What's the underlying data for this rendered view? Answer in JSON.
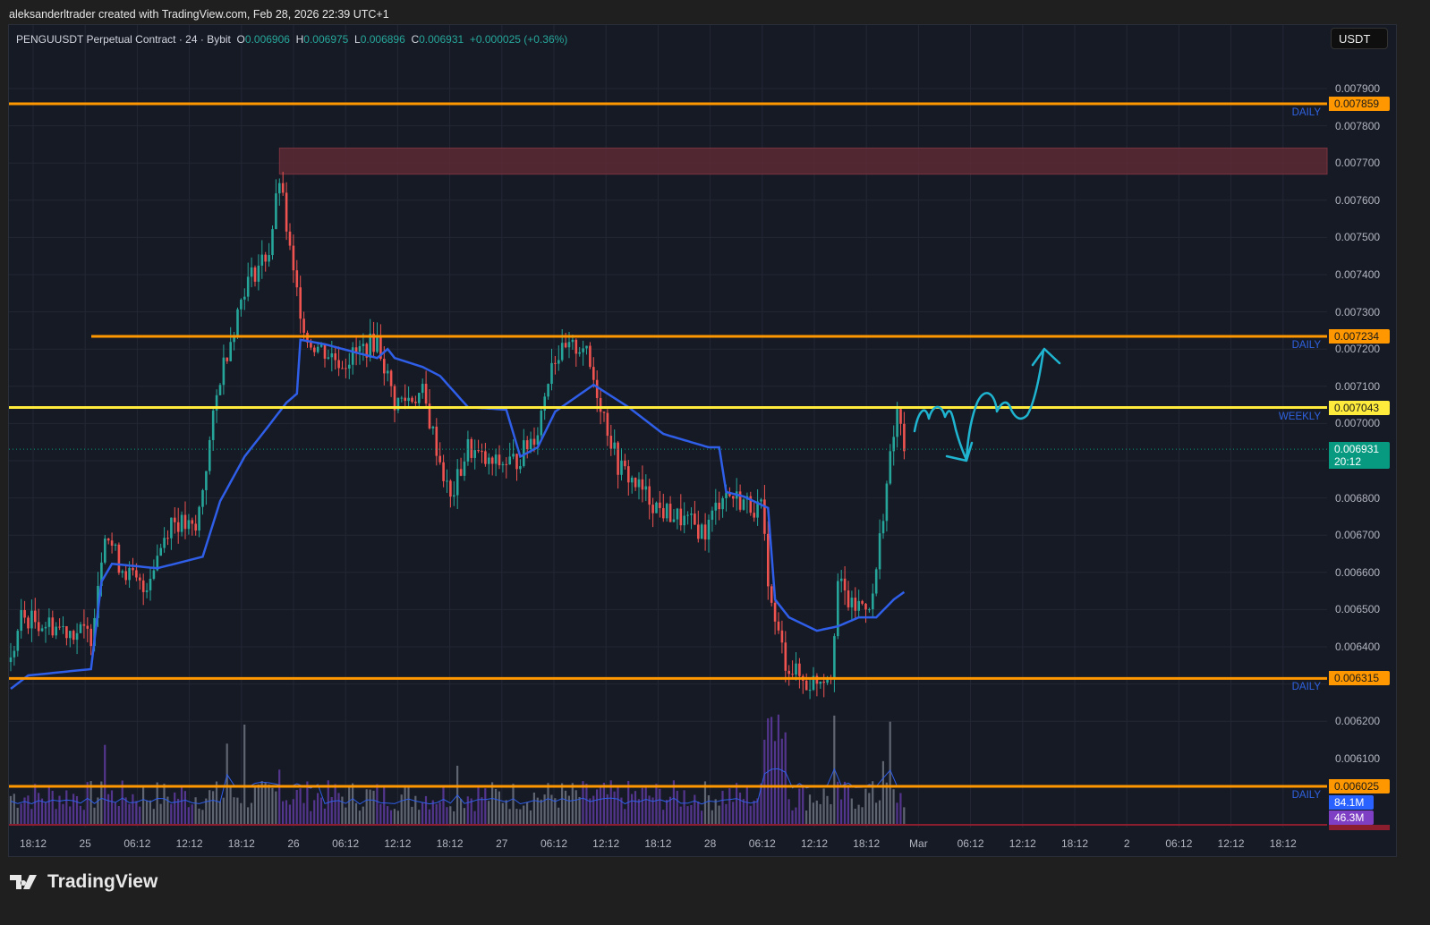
{
  "credit": "aleksanderltrader created with TradingView.com, Feb 28, 2026 22:39 UTC+1",
  "legend": {
    "symbol": "PENGUUSDT Perpetual Contract · 24 · Bybit",
    "o_label": "O",
    "o": "0.006906",
    "h_label": "H",
    "h": "0.006975",
    "l_label": "L",
    "l": "0.006896",
    "c_label": "C",
    "c": "0.006931",
    "change": "+0.000025 (+0.36%)"
  },
  "currency_button": "USDT",
  "price_axis": {
    "range": [
      0.00588,
      0.00798
    ],
    "labels": [
      "0.007900",
      "0.007800",
      "0.007700",
      "0.007600",
      "0.007500",
      "0.007400",
      "0.007300",
      "0.007200",
      "0.007100",
      "0.007000",
      "0.006800",
      "0.006700",
      "0.006600",
      "0.006500",
      "0.006400",
      "0.006200",
      "0.006100"
    ]
  },
  "levels": [
    {
      "price": 0.007859,
      "label": "0.007859",
      "name": "DAILY",
      "color": "#ff9800",
      "start_index": 0
    },
    {
      "price": 0.007234,
      "label": "0.007234",
      "name": "DAILY",
      "color": "#ff9800",
      "start_index": 24
    },
    {
      "price": 0.007043,
      "label": "0.007043",
      "name": "WEEKLY",
      "color": "#ffeb3b",
      "start_index": 0
    },
    {
      "price": 0.006315,
      "label": "0.006315",
      "name": "DAILY",
      "color": "#ff9800",
      "start_index": 0
    },
    {
      "price": 0.006025,
      "label": "0.006025",
      "name": "DAILY",
      "color": "#ff9800",
      "start_index": 0
    }
  ],
  "supply_zone": {
    "top": 0.00774,
    "bottom": 0.00767,
    "start_index": 77,
    "color": "#5c2a35"
  },
  "current_price": {
    "label": "0.006931",
    "countdown": "20:12",
    "color": "#089981"
  },
  "volume_tags": [
    {
      "label": "84.1M",
      "color": "#2962ff"
    },
    {
      "label": "46.3M",
      "color": "#7e3fc4"
    }
  ],
  "time_axis": [
    "18:12",
    "25",
    "06:12",
    "12:12",
    "18:12",
    "26",
    "06:12",
    "12:12",
    "18:12",
    "27",
    "06:12",
    "12:12",
    "18:12",
    "28",
    "06:12",
    "12:12",
    "18:12",
    "Mar",
    "06:12",
    "12:12",
    "18:12",
    "2",
    "06:12",
    "12:12",
    "18:12"
  ],
  "colors": {
    "up": "#26a69a",
    "down": "#ef5350",
    "ma": "#2f5ee8",
    "annotation": "#1fb5d1"
  },
  "chart_data": {
    "type": "candlestick",
    "symbol": "PENGUUSDT",
    "interval_minutes": 24,
    "candles_per_time_label": 15,
    "close_waypoints": [
      [
        0,
        0.006359
      ],
      [
        3,
        0.006479
      ],
      [
        23,
        0.006431
      ],
      [
        27,
        0.00672
      ],
      [
        31,
        0.006624
      ],
      [
        38,
        0.006551
      ],
      [
        46,
        0.006744
      ],
      [
        53,
        0.006708
      ],
      [
        60,
        0.007128
      ],
      [
        67,
        0.007369
      ],
      [
        74,
        0.007465
      ],
      [
        77,
        0.007657
      ],
      [
        81,
        0.007393
      ],
      [
        85,
        0.007225
      ],
      [
        95,
        0.007164
      ],
      [
        105,
        0.007225
      ],
      [
        110,
        0.007056
      ],
      [
        118,
        0.00708
      ],
      [
        126,
        0.006792
      ],
      [
        131,
        0.006936
      ],
      [
        137,
        0.006888
      ],
      [
        145,
        0.0069
      ],
      [
        151,
        0.006984
      ],
      [
        155,
        0.007176
      ],
      [
        164,
        0.007212
      ],
      [
        169,
        0.007056
      ],
      [
        174,
        0.006888
      ],
      [
        186,
        0.006768
      ],
      [
        192,
        0.006744
      ],
      [
        199,
        0.006708
      ],
      [
        204,
        0.006816
      ],
      [
        215,
        0.006768
      ],
      [
        218,
        0.006503
      ],
      [
        222,
        0.006359
      ],
      [
        228,
        0.006299
      ],
      [
        235,
        0.006335
      ],
      [
        237,
        0.006575
      ],
      [
        241,
        0.006503
      ],
      [
        247,
        0.006527
      ],
      [
        250,
        0.006768
      ],
      [
        254,
        0.007032
      ],
      [
        256,
        0.006931
      ]
    ],
    "ma_waypoints": [
      [
        0,
        0.006287
      ],
      [
        5,
        0.006323
      ],
      [
        23,
        0.00634
      ],
      [
        26,
        0.006575
      ],
      [
        29,
        0.006623
      ],
      [
        42,
        0.006611
      ],
      [
        55,
        0.006642
      ],
      [
        60,
        0.006791
      ],
      [
        67,
        0.006911
      ],
      [
        74,
        0.006995
      ],
      [
        79,
        0.007056
      ],
      [
        82,
        0.00708
      ],
      [
        83,
        0.007225
      ],
      [
        90,
        0.007213
      ],
      [
        100,
        0.007188
      ],
      [
        105,
        0.007176
      ],
      [
        108,
        0.0072
      ],
      [
        110,
        0.007176
      ],
      [
        118,
        0.007152
      ],
      [
        123,
        0.007128
      ],
      [
        131,
        0.007044
      ],
      [
        142,
        0.007037
      ],
      [
        146,
        0.006911
      ],
      [
        151,
        0.006936
      ],
      [
        156,
        0.007032
      ],
      [
        167,
        0.007104
      ],
      [
        177,
        0.007044
      ],
      [
        187,
        0.006972
      ],
      [
        200,
        0.006936
      ],
      [
        203,
        0.006936
      ],
      [
        205,
        0.006816
      ],
      [
        210,
        0.006804
      ],
      [
        217,
        0.006773
      ],
      [
        219,
        0.006527
      ],
      [
        223,
        0.006479
      ],
      [
        231,
        0.006443
      ],
      [
        237,
        0.006455
      ],
      [
        243,
        0.006479
      ],
      [
        248,
        0.006479
      ],
      [
        253,
        0.006527
      ],
      [
        256,
        0.006547
      ]
    ]
  }
}
